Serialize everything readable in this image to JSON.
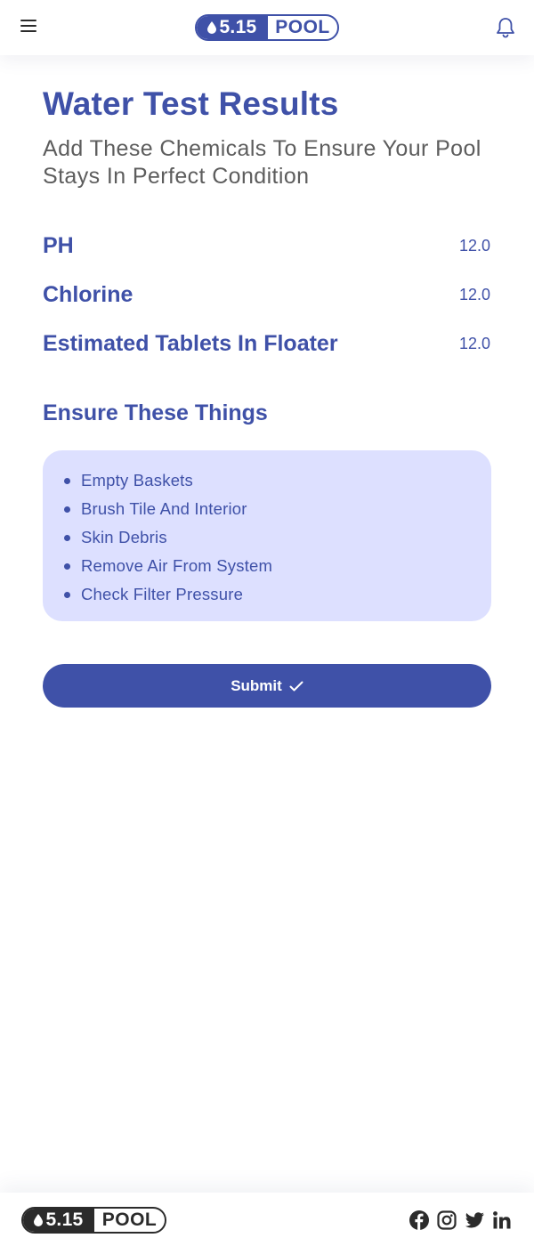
{
  "header": {
    "logo_number": "5.15",
    "logo_word": "POOL",
    "menu_icon": "hamburger-menu-icon",
    "notification_icon": "bell-icon"
  },
  "page": {
    "title": "Water Test Results",
    "subtitle": "Add These Chemicals To Ensure Your Pool Stays In Perfect Condition"
  },
  "results": [
    {
      "label": "PH",
      "value": "12.0"
    },
    {
      "label": "Chlorine",
      "value": "12.0"
    },
    {
      "label": "Estimated Tablets In Floater",
      "value": "12.0"
    }
  ],
  "checklist": {
    "title": "Ensure These Things",
    "items": [
      "Empty Baskets",
      "Brush Tile And Interior",
      "Skin Debris",
      "Remove Air From System",
      "Check Filter Pressure"
    ]
  },
  "submit": {
    "label": "Submit",
    "icon": "checkmark-icon"
  },
  "footer": {
    "logo_number": "5.15",
    "logo_word": "POOL",
    "social_icons": [
      "facebook-icon",
      "instagram-icon",
      "twitter-icon",
      "linkedin-icon"
    ]
  },
  "colors": {
    "primary": "#3f51a8",
    "panel": "#dde0ff",
    "subtitle_text": "#5d5d5d",
    "dark": "#2b2b2b"
  }
}
